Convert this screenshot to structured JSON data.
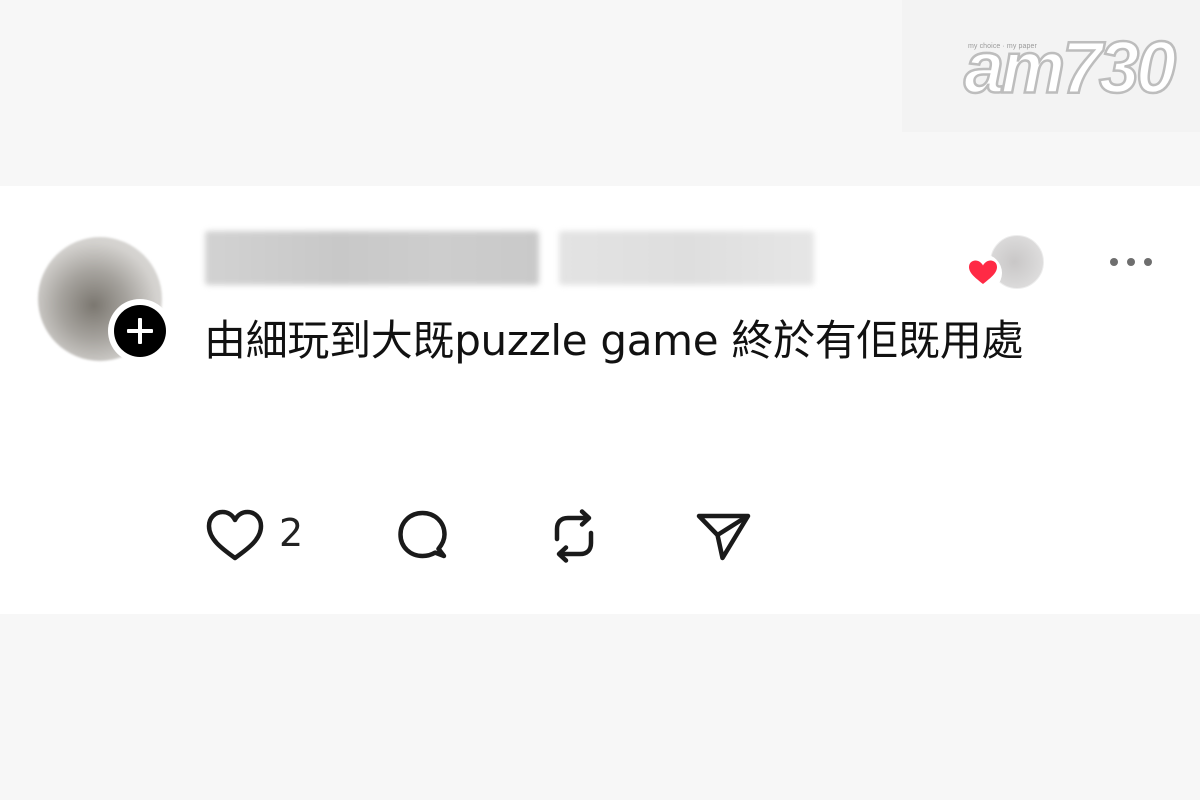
{
  "watermark": {
    "tagline": "my choice · my paper",
    "logo_text": "am730"
  },
  "post": {
    "author_name": "",
    "post_meta": "",
    "text": "由細玩到大既puzzle game 終於有佢既用處",
    "like_count": "2"
  },
  "icons": {
    "follow": "plus-icon",
    "more": "more-dots-icon",
    "liker": "heart-icon",
    "like": "heart-outline-icon",
    "comment": "comment-bubble-icon",
    "repost": "repost-icon",
    "share": "send-icon"
  },
  "colors": {
    "heart_red": "#ff2a45",
    "icon_color": "#1a1a1a",
    "card_bg": "#ffffff",
    "page_bg": "#f7f7f7"
  }
}
